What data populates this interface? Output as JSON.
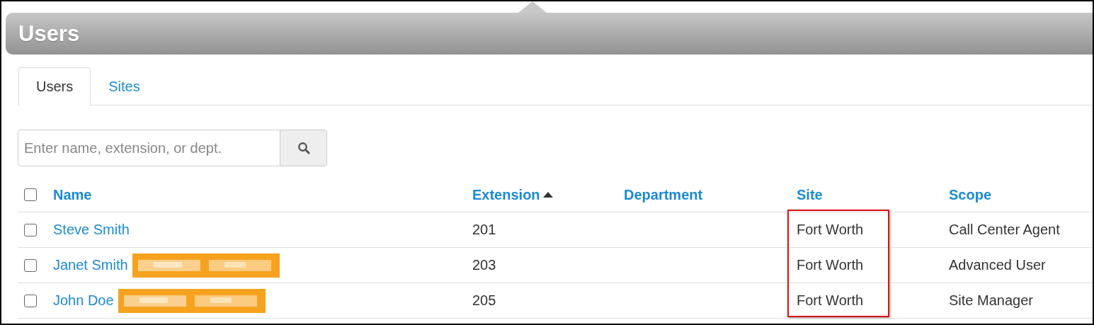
{
  "header": {
    "title": "Users"
  },
  "tabs": [
    {
      "label": "Users",
      "selected": true
    },
    {
      "label": "Sites",
      "selected": false
    }
  ],
  "search": {
    "placeholder": "Enter name, extension, or dept."
  },
  "table": {
    "select_all": {
      "checked": false
    },
    "columns": [
      {
        "label": "Name",
        "sorted": false
      },
      {
        "label": "Extension",
        "sorted": true
      },
      {
        "label": "Department",
        "sorted": false
      },
      {
        "label": "Site",
        "sorted": false
      },
      {
        "label": "Scope",
        "sorted": false
      }
    ],
    "site_highlighted": true,
    "rows": [
      {
        "checked": false,
        "name": "Steve Smith",
        "redacted": false,
        "extension": "201",
        "site": "Fort Worth",
        "scope": "Call Center Agent"
      },
      {
        "checked": false,
        "name": "Janet Smith",
        "redacted": true,
        "extension": "203",
        "site": "Fort Worth",
        "scope": "Advanced User"
      },
      {
        "checked": false,
        "name": "John Doe",
        "redacted": true,
        "extension": "205",
        "site": "Fort Worth",
        "scope": "Site Manager"
      }
    ]
  }
}
